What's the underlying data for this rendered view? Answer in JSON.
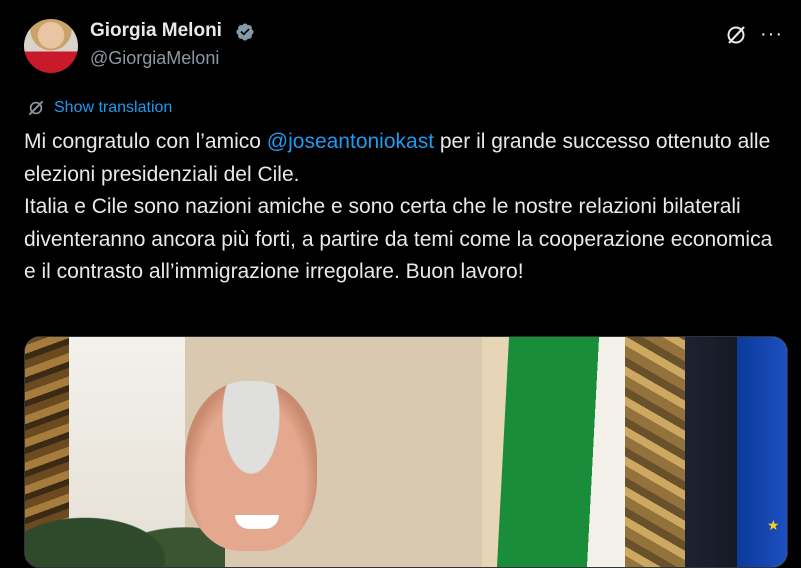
{
  "author": {
    "name": "Giorgia Meloni",
    "handle": "@GiorgiaMeloni",
    "verified": true
  },
  "colors": {
    "background": "#000000",
    "text": "#e7e9ea",
    "secondary_text": "#8b98a5",
    "link": "#1d9bf0"
  },
  "icons": {
    "verified": "verified-badge-icon",
    "grok": "grok-icon",
    "more": "more-options-icon",
    "translate": "translate-icon"
  },
  "translation": {
    "label": "Show translation"
  },
  "tweet": {
    "line1_before": "Mi congratulo con l’amico ",
    "mention": "@joseantoniokast",
    "line1_after": " per il grande successo ottenuto alle elezioni presidenziali del Cile.",
    "paragraph2": "Italia e Cile sono nazioni amiche e sono certa che le nostre relazioni bilaterali diventeranno ancora più forti, a partire da temi come la cooperazione economica e il contrasto all’immigrazione irregolare. Buon lavoro!"
  },
  "more_symbol": "···"
}
